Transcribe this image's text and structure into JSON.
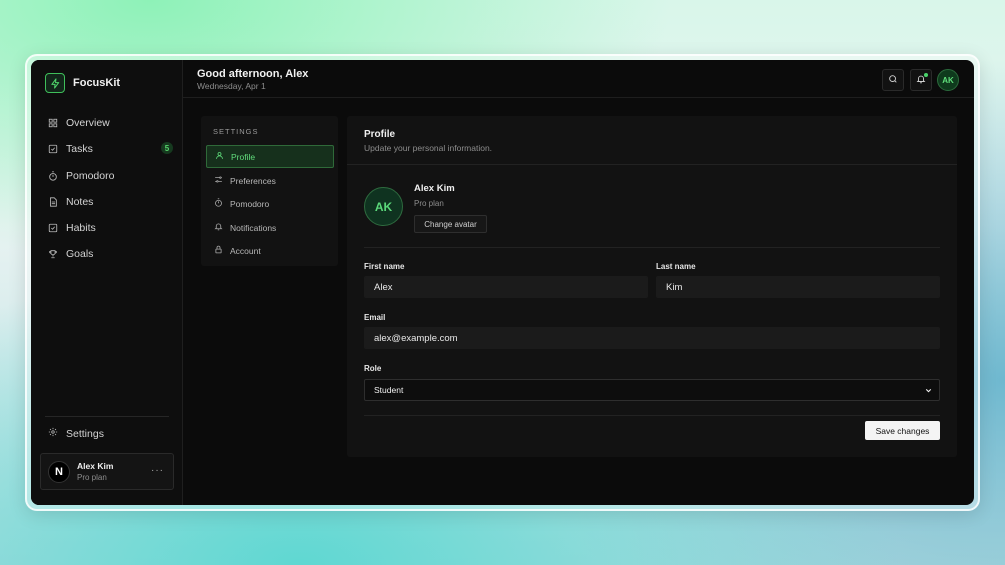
{
  "app": {
    "name": "FocusKit",
    "accent": "#49d36a"
  },
  "sidebar": {
    "items": [
      {
        "label": "Overview",
        "icon": "grid-icon"
      },
      {
        "label": "Tasks",
        "icon": "check-square-icon",
        "badge": "5"
      },
      {
        "label": "Pomodoro",
        "icon": "timer-icon"
      },
      {
        "label": "Notes",
        "icon": "document-icon"
      },
      {
        "label": "Habits",
        "icon": "check-square-icon"
      },
      {
        "label": "Goals",
        "icon": "trophy-icon"
      }
    ],
    "settings_label": "Settings",
    "user": {
      "initial": "N",
      "name": "Alex Kim",
      "plan": "Pro plan",
      "more": "···"
    }
  },
  "header": {
    "greeting": "Good afternoon, Alex",
    "date": "Wednesday, Apr 1",
    "avatar_initials": "AK"
  },
  "settings_nav": {
    "title": "SETTINGS",
    "items": [
      {
        "label": "Profile",
        "icon": "user-icon"
      },
      {
        "label": "Preferences",
        "icon": "sliders-icon"
      },
      {
        "label": "Pomodoro",
        "icon": "timer-icon"
      },
      {
        "label": "Notifications",
        "icon": "bell-icon"
      },
      {
        "label": "Account",
        "icon": "lock-icon"
      }
    ]
  },
  "profile": {
    "title": "Profile",
    "subtitle": "Update your personal information.",
    "avatar_initials": "AK",
    "name": "Alex Kim",
    "plan": "Pro plan",
    "change_avatar": "Change avatar",
    "first_name_label": "First name",
    "first_name": "Alex",
    "last_name_label": "Last name",
    "last_name": "Kim",
    "email_label": "Email",
    "email": "alex@example.com",
    "role_label": "Role",
    "role": "Student",
    "save_label": "Save changes"
  }
}
